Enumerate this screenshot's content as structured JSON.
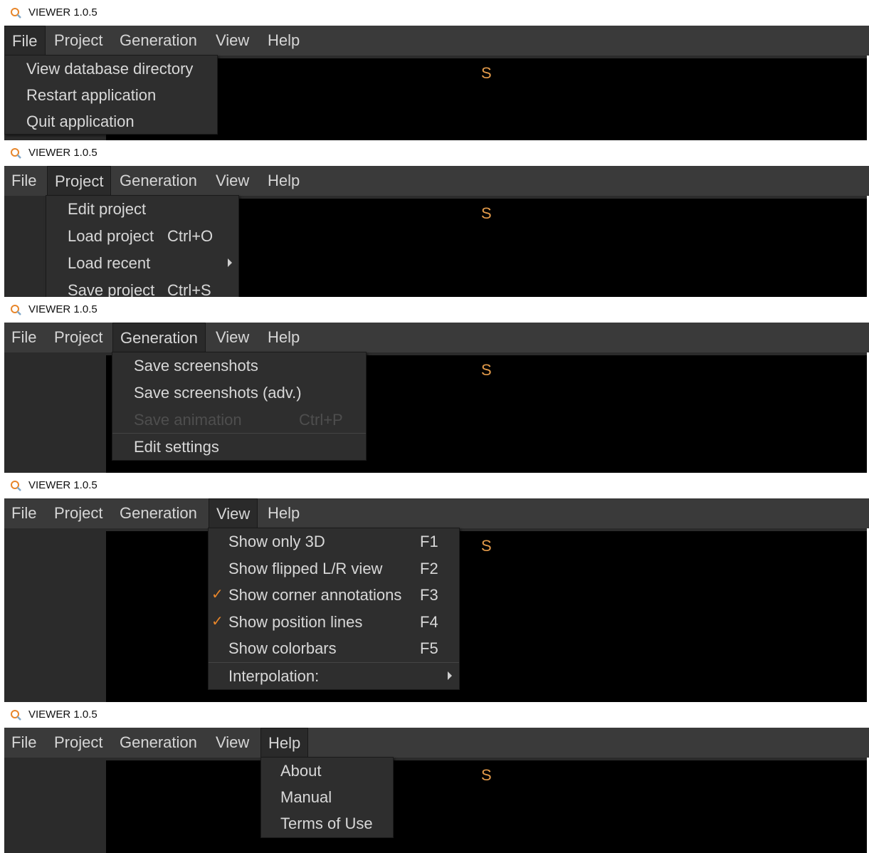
{
  "app": {
    "title": "VIEWER 1.0.5",
    "viewport_marker": "S"
  },
  "menubar": [
    "File",
    "Project",
    "Generation",
    "View",
    "Help"
  ],
  "file_menu": [
    "View database directory",
    "Restart application",
    "Quit application"
  ],
  "project_menu": [
    {
      "label": "Edit project",
      "shortcut": ""
    },
    {
      "label": "Load project",
      "shortcut": "Ctrl+O"
    },
    {
      "label": "Load recent",
      "shortcut": "",
      "submenu": true
    },
    {
      "label": "Save project",
      "shortcut": "Ctrl+S"
    }
  ],
  "generation_menu": [
    {
      "label": "Save screenshots",
      "shortcut": ""
    },
    {
      "label": "Save screenshots (adv.)",
      "shortcut": ""
    },
    {
      "label": "Save animation",
      "shortcut": "Ctrl+P",
      "disabled": true
    },
    {
      "label": "Edit settings",
      "shortcut": ""
    }
  ],
  "view_menu": [
    {
      "label": "Show only 3D",
      "shortcut": "F1",
      "checked": false
    },
    {
      "label": "Show flipped L/R view",
      "shortcut": "F2",
      "checked": false
    },
    {
      "label": "Show corner annotations",
      "shortcut": "F3",
      "checked": true
    },
    {
      "label": "Show position lines",
      "shortcut": "F4",
      "checked": true
    },
    {
      "label": "Show colorbars",
      "shortcut": "F5",
      "checked": false
    },
    {
      "label": "Interpolation:",
      "shortcut": "",
      "submenu": true
    }
  ],
  "help_menu": [
    "About",
    "Manual",
    "Terms of Use"
  ],
  "colors": {
    "accent_check": "#e8862a",
    "marker": "#e29a4a",
    "menubar_bg": "#3a3a3a",
    "viewport_bg": "#000000"
  }
}
